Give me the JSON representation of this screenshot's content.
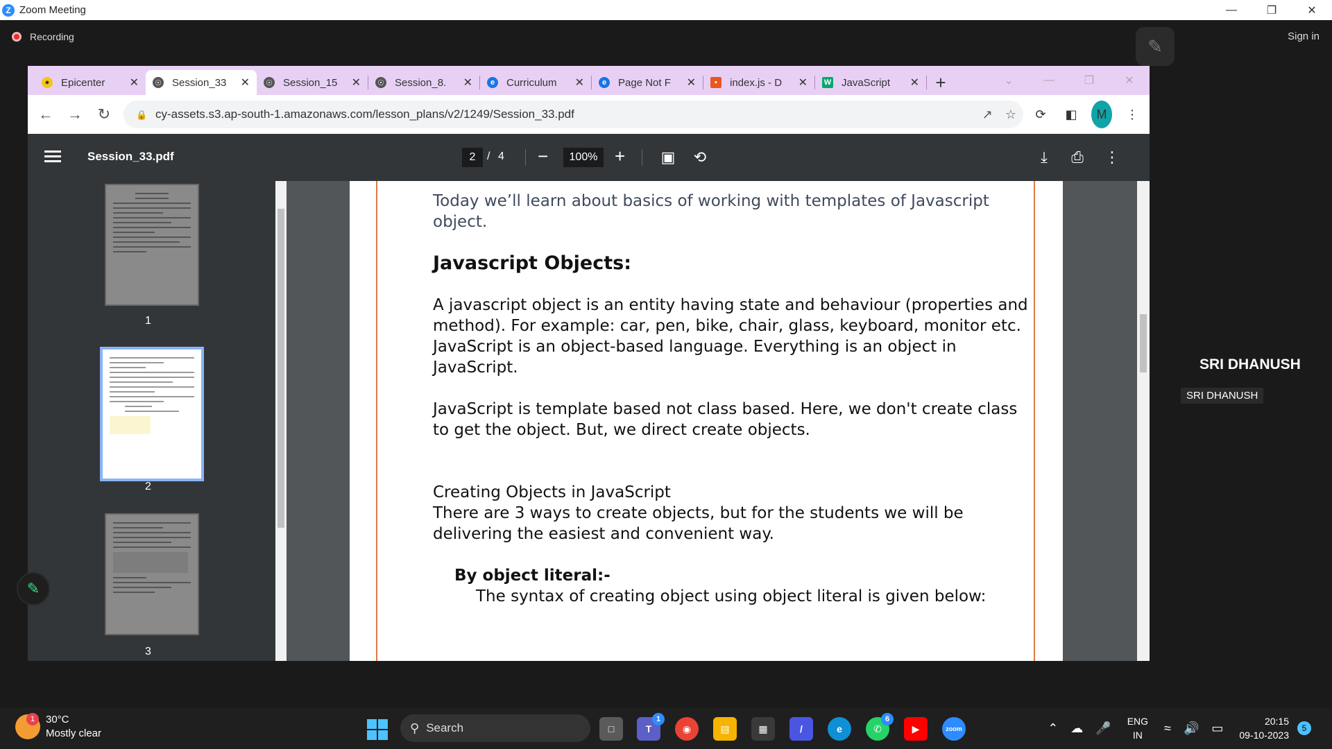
{
  "zoom": {
    "title": "Zoom Meeting",
    "recording": "Recording",
    "sign_in": "Sign in",
    "participant_name": "SRI DHANUSH",
    "participant_tag": "SRI DHANUSH"
  },
  "browser": {
    "tabs": [
      {
        "label": "Epicenter",
        "icon": "lock-icon-yellow",
        "color": "#f5c518"
      },
      {
        "label": "Session_33",
        "icon": "globe-icon",
        "color": "#555555",
        "active": true
      },
      {
        "label": "Session_15",
        "icon": "globe-icon",
        "color": "#555555"
      },
      {
        "label": "Session_8.",
        "icon": "globe-icon",
        "color": "#555555"
      },
      {
        "label": "Curriculum",
        "icon": "e-logo-icon",
        "color": "#1a73e8"
      },
      {
        "label": "Page Not F",
        "icon": "e-logo-icon",
        "color": "#1a73e8"
      },
      {
        "label": "index.js - D",
        "icon": "codesandbox-icon",
        "color": "#e8571f"
      },
      {
        "label": "JavaScript",
        "icon": "w3-icon",
        "color": "#04aa6d"
      }
    ],
    "url": "cy-assets.s3.ap-south-1.amazonaws.com/lesson_plans/v2/1249/Session_33.pdf",
    "avatar_letter": "M"
  },
  "pdf": {
    "filename": "Session_33.pdf",
    "current_page": "2",
    "separator": "/",
    "total_pages": "4",
    "zoom": "100%",
    "thumbnails": [
      "1",
      "2",
      "3"
    ],
    "content": {
      "intro": "Today we’ll learn about basics of working with templates of Javascript object.",
      "heading": "Javascript Objects:",
      "p1": "A javascript object is an entity having state and behaviour (properties and method). For example: car, pen, bike, chair, glass, keyboard, monitor etc.",
      "p1b": "JavaScript is an object-based language. Everything is an object in JavaScript.",
      "p2": "JavaScript is template based not class based. Here, we don't create class to get the object. But, we direct create objects.",
      "p3a": "Creating Objects in JavaScript",
      "p3b": "There are 3 ways to create objects, but for the students we will be delivering the easiest and convenient way.",
      "subheading": "By object literal:-",
      "p4": "The syntax of creating object using object literal is given below:"
    }
  },
  "taskbar": {
    "temperature": "30°C",
    "weather": "Mostly clear",
    "weather_badge": "1",
    "search": "Search",
    "teams_badge": "1",
    "whatsapp_badge": "6",
    "zoom_label": "zoom",
    "lang_top": "ENG",
    "lang_bottom": "IN",
    "time": "20:15",
    "date": "09-10-2023",
    "notifications": "5"
  }
}
